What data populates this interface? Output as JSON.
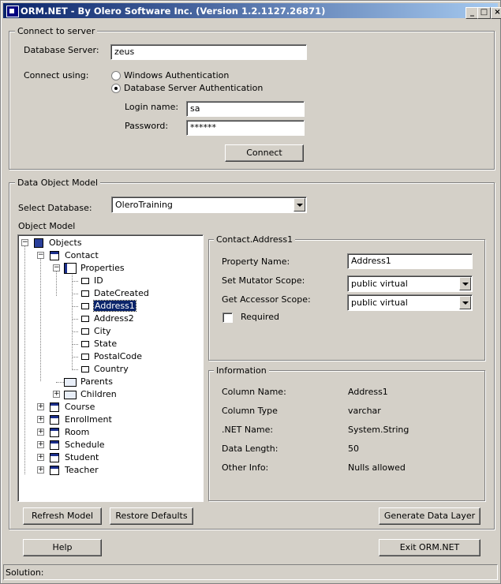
{
  "window": {
    "title": "ORM.NET - By Olero Software Inc. (Version 1.2.1127.26871)",
    "min": "_",
    "max": "□",
    "close": "×"
  },
  "connect": {
    "group": "Connect to server",
    "server_label": "Database Server:",
    "server_value": "zeus",
    "using_label": "Connect using:",
    "auth_windows": "Windows Authentication",
    "auth_server": "Database Server Authentication",
    "auth_selected": "server",
    "login_label": "Login name:",
    "login_value": "sa",
    "password_label": "Password:",
    "password_value": "******",
    "connect_button": "Connect"
  },
  "model": {
    "group": "Data Object Model",
    "select_db_label": "Select Database:",
    "select_db_value": "OleroTraining",
    "object_model_label": "Object Model",
    "tree": {
      "root": "Objects",
      "contact": "Contact",
      "properties": "Properties",
      "props": [
        "ID",
        "DateCreated",
        "Address1",
        "Address2",
        "City",
        "State",
        "PostalCode",
        "Country"
      ],
      "selected": "Address1",
      "parents": "Parents",
      "children": "Children",
      "others": [
        "Course",
        "Enrollment",
        "Room",
        "Schedule",
        "Student",
        "Teacher"
      ]
    },
    "details": {
      "group": "Contact.Address1",
      "property_name_label": "Property Name:",
      "property_name_value": "Address1",
      "mutator_label": "Set Mutator Scope:",
      "mutator_value": "public virtual",
      "accessor_label": "Get Accessor Scope:",
      "accessor_value": "public virtual",
      "required_label": "Required"
    },
    "info": {
      "group": "Information",
      "rows": [
        {
          "label": "Column Name:",
          "value": "Address1"
        },
        {
          "label": "Column Type",
          "value": "varchar"
        },
        {
          "label": ".NET Name:",
          "value": "System.String"
        },
        {
          "label": "Data Length:",
          "value": "50"
        },
        {
          "label": "Other Info:",
          "value": "Nulls allowed"
        }
      ]
    },
    "refresh_button": "Refresh Model",
    "restore_button": "Restore Defaults",
    "generate_button": "Generate Data Layer"
  },
  "footer": {
    "help_button": "Help",
    "exit_button": "Exit ORM.NET",
    "status_label": "Solution:"
  }
}
